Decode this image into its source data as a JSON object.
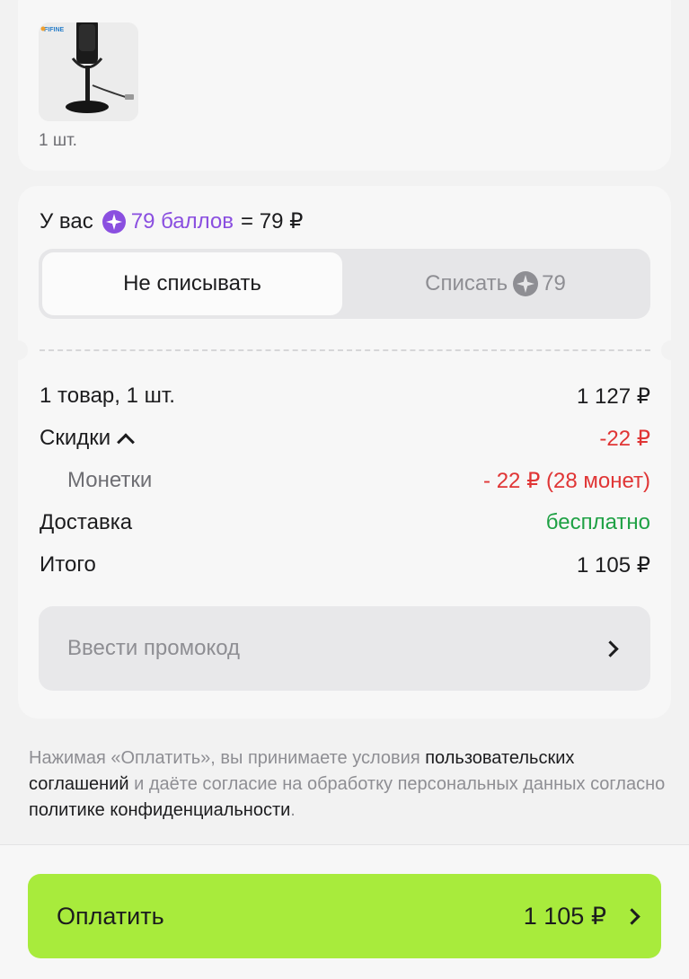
{
  "product": {
    "brand_logo": "FIFINE",
    "image": "usb-microphone-on-stand",
    "quantity": "1 шт."
  },
  "points": {
    "prefix": "У вас",
    "amount": "79 баллов",
    "equals": "= 79 ₽",
    "option_keep": "Не списывать",
    "option_spend": "Списать",
    "option_spend_value": "79",
    "selected": "option_keep"
  },
  "summary": {
    "items_label": "1 товар, 1 шт.",
    "items_value": "1 127 ₽",
    "discounts_label": "Скидки",
    "discounts_value": "-22 ₽",
    "coins_label": "Монетки",
    "coins_value": "- 22 ₽ (28 монет)",
    "delivery_label": "Доставка",
    "delivery_value": "бесплатно",
    "total_label": "Итого",
    "total_value": "1 105 ₽"
  },
  "promo": {
    "label": "Ввести промокод"
  },
  "legal": {
    "part1": "Нажимая «Оплатить», вы принимаете условия ",
    "link1": "пользовательских соглашений",
    "part2": " и даёте согласие на обработку персональных данных согласно ",
    "link2": "политике конфиденциальности",
    "part3": "."
  },
  "pay": {
    "label": "Оплатить",
    "amount": "1 105 ₽"
  },
  "colors": {
    "accent_points": "#8a4fe0",
    "discount_red": "#e03535",
    "free_green": "#1fa145",
    "pay_button": "#a8eb3c"
  }
}
